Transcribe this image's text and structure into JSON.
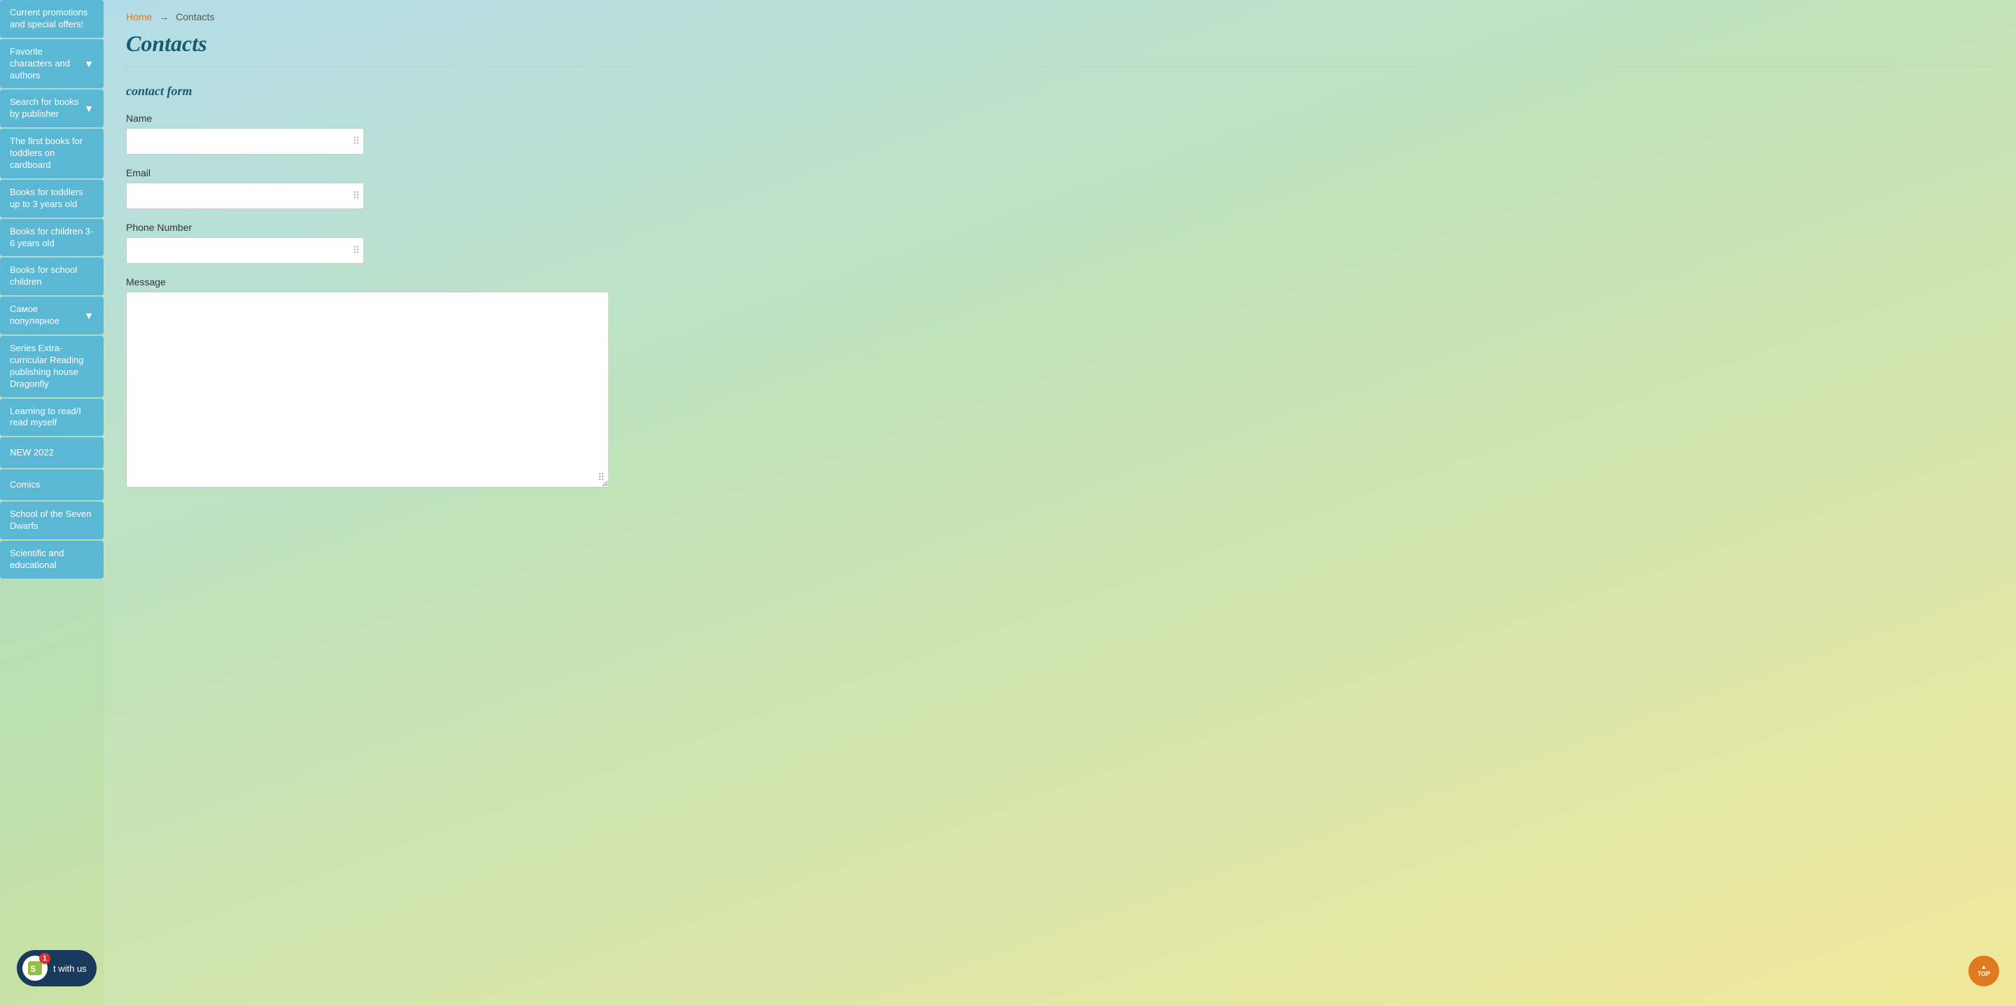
{
  "breadcrumb": {
    "home": "Home",
    "separator": "→",
    "current": "Contacts"
  },
  "page": {
    "title": "Contacts"
  },
  "form": {
    "section_title": "contact form",
    "name_label": "Name",
    "email_label": "Email",
    "phone_label": "Phone Number",
    "message_label": "Message"
  },
  "sidebar": {
    "items": [
      {
        "label": "Current promotions and special offers!",
        "has_arrow": false
      },
      {
        "label": "Favorite characters and authors",
        "has_arrow": true
      },
      {
        "label": "Search for books by publisher",
        "has_arrow": true
      },
      {
        "label": "The first books for toddlers on cardboard",
        "has_arrow": false
      },
      {
        "label": "Books for toddlers up to 3 years old",
        "has_arrow": false
      },
      {
        "label": "Books for children 3-6 years old",
        "has_arrow": false
      },
      {
        "label": "Books for school children",
        "has_arrow": false
      },
      {
        "label": "Самое популярное",
        "has_arrow": true
      },
      {
        "label": "Series Extra-curricular Reading publishing house Dragonfly",
        "has_arrow": false
      },
      {
        "label": "Learning to read/I read myself",
        "has_arrow": false
      },
      {
        "label": "NEW 2022",
        "has_arrow": false
      },
      {
        "label": "Comics",
        "has_arrow": false
      },
      {
        "label": "School of the Seven Dwarfs",
        "has_arrow": false
      },
      {
        "label": "Scientific and educational",
        "has_arrow": false
      }
    ]
  },
  "chat_widget": {
    "label": "t with us",
    "badge": "1"
  },
  "back_to_top": {
    "label": "TOP"
  }
}
